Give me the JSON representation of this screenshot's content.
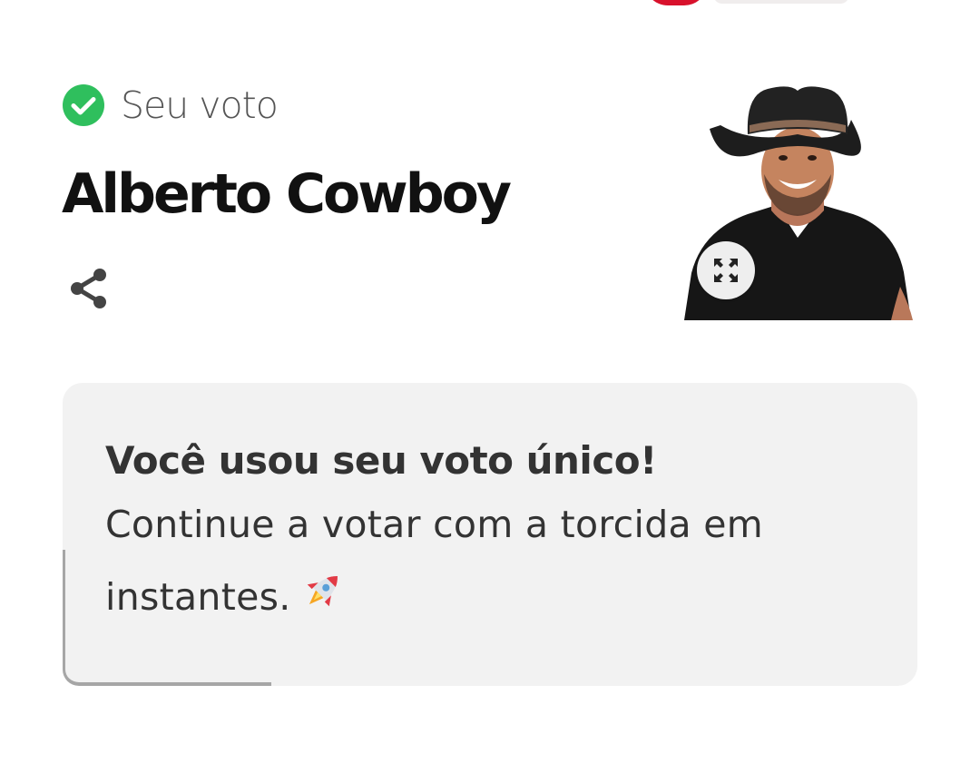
{
  "colors": {
    "check_green": "#2fbf5d",
    "brand_red": "#d8112c",
    "card_background": "#f2f2f2"
  },
  "vote": {
    "label": "Seu voto",
    "status_icon": "check-circle-icon",
    "candidate_name": "Alberto Cowboy",
    "share_icon": "share-icon",
    "expand_icon": "expand-icon"
  },
  "card": {
    "title": "Você usou seu voto único!",
    "body": "Continue a votar com a torcida em instantes.",
    "emoji_icon": "rocket-icon"
  }
}
